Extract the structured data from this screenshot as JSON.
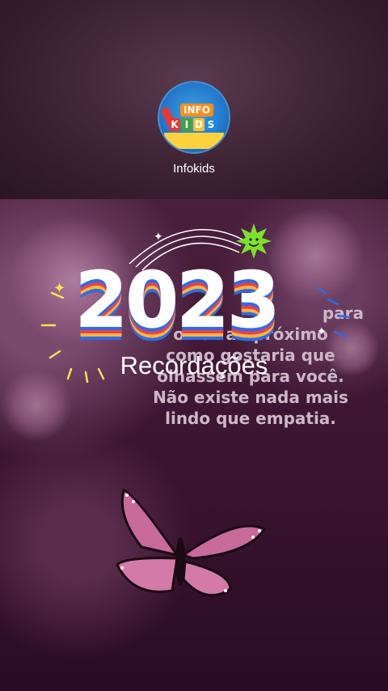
{
  "channel": {
    "name": "Infokids",
    "avatar": {
      "info_label": "INFO",
      "kids_letters": [
        "K",
        "I",
        "D",
        "S"
      ],
      "kids_colors": [
        "#e53935",
        "#43a047",
        "#fbc02d",
        "#1e88e5"
      ]
    }
  },
  "overlay": {
    "year": "2023",
    "subtitle": "Recordações"
  },
  "quote": {
    "lines": [
      "para",
      "olhar ao próximo",
      "como gostaria que",
      "olhassem para você.",
      "Não existe nada mais",
      "lindo que empatia."
    ]
  },
  "icons": {
    "sun": "smiling-sun-icon",
    "sparkle": "sparkle-icon",
    "butterfly": "butterfly-icon"
  },
  "colors": {
    "background": "#2a0f22",
    "accent_blue": "#2e6be6",
    "accent_red": "#e8424a",
    "accent_yellow": "#f6b73c"
  }
}
